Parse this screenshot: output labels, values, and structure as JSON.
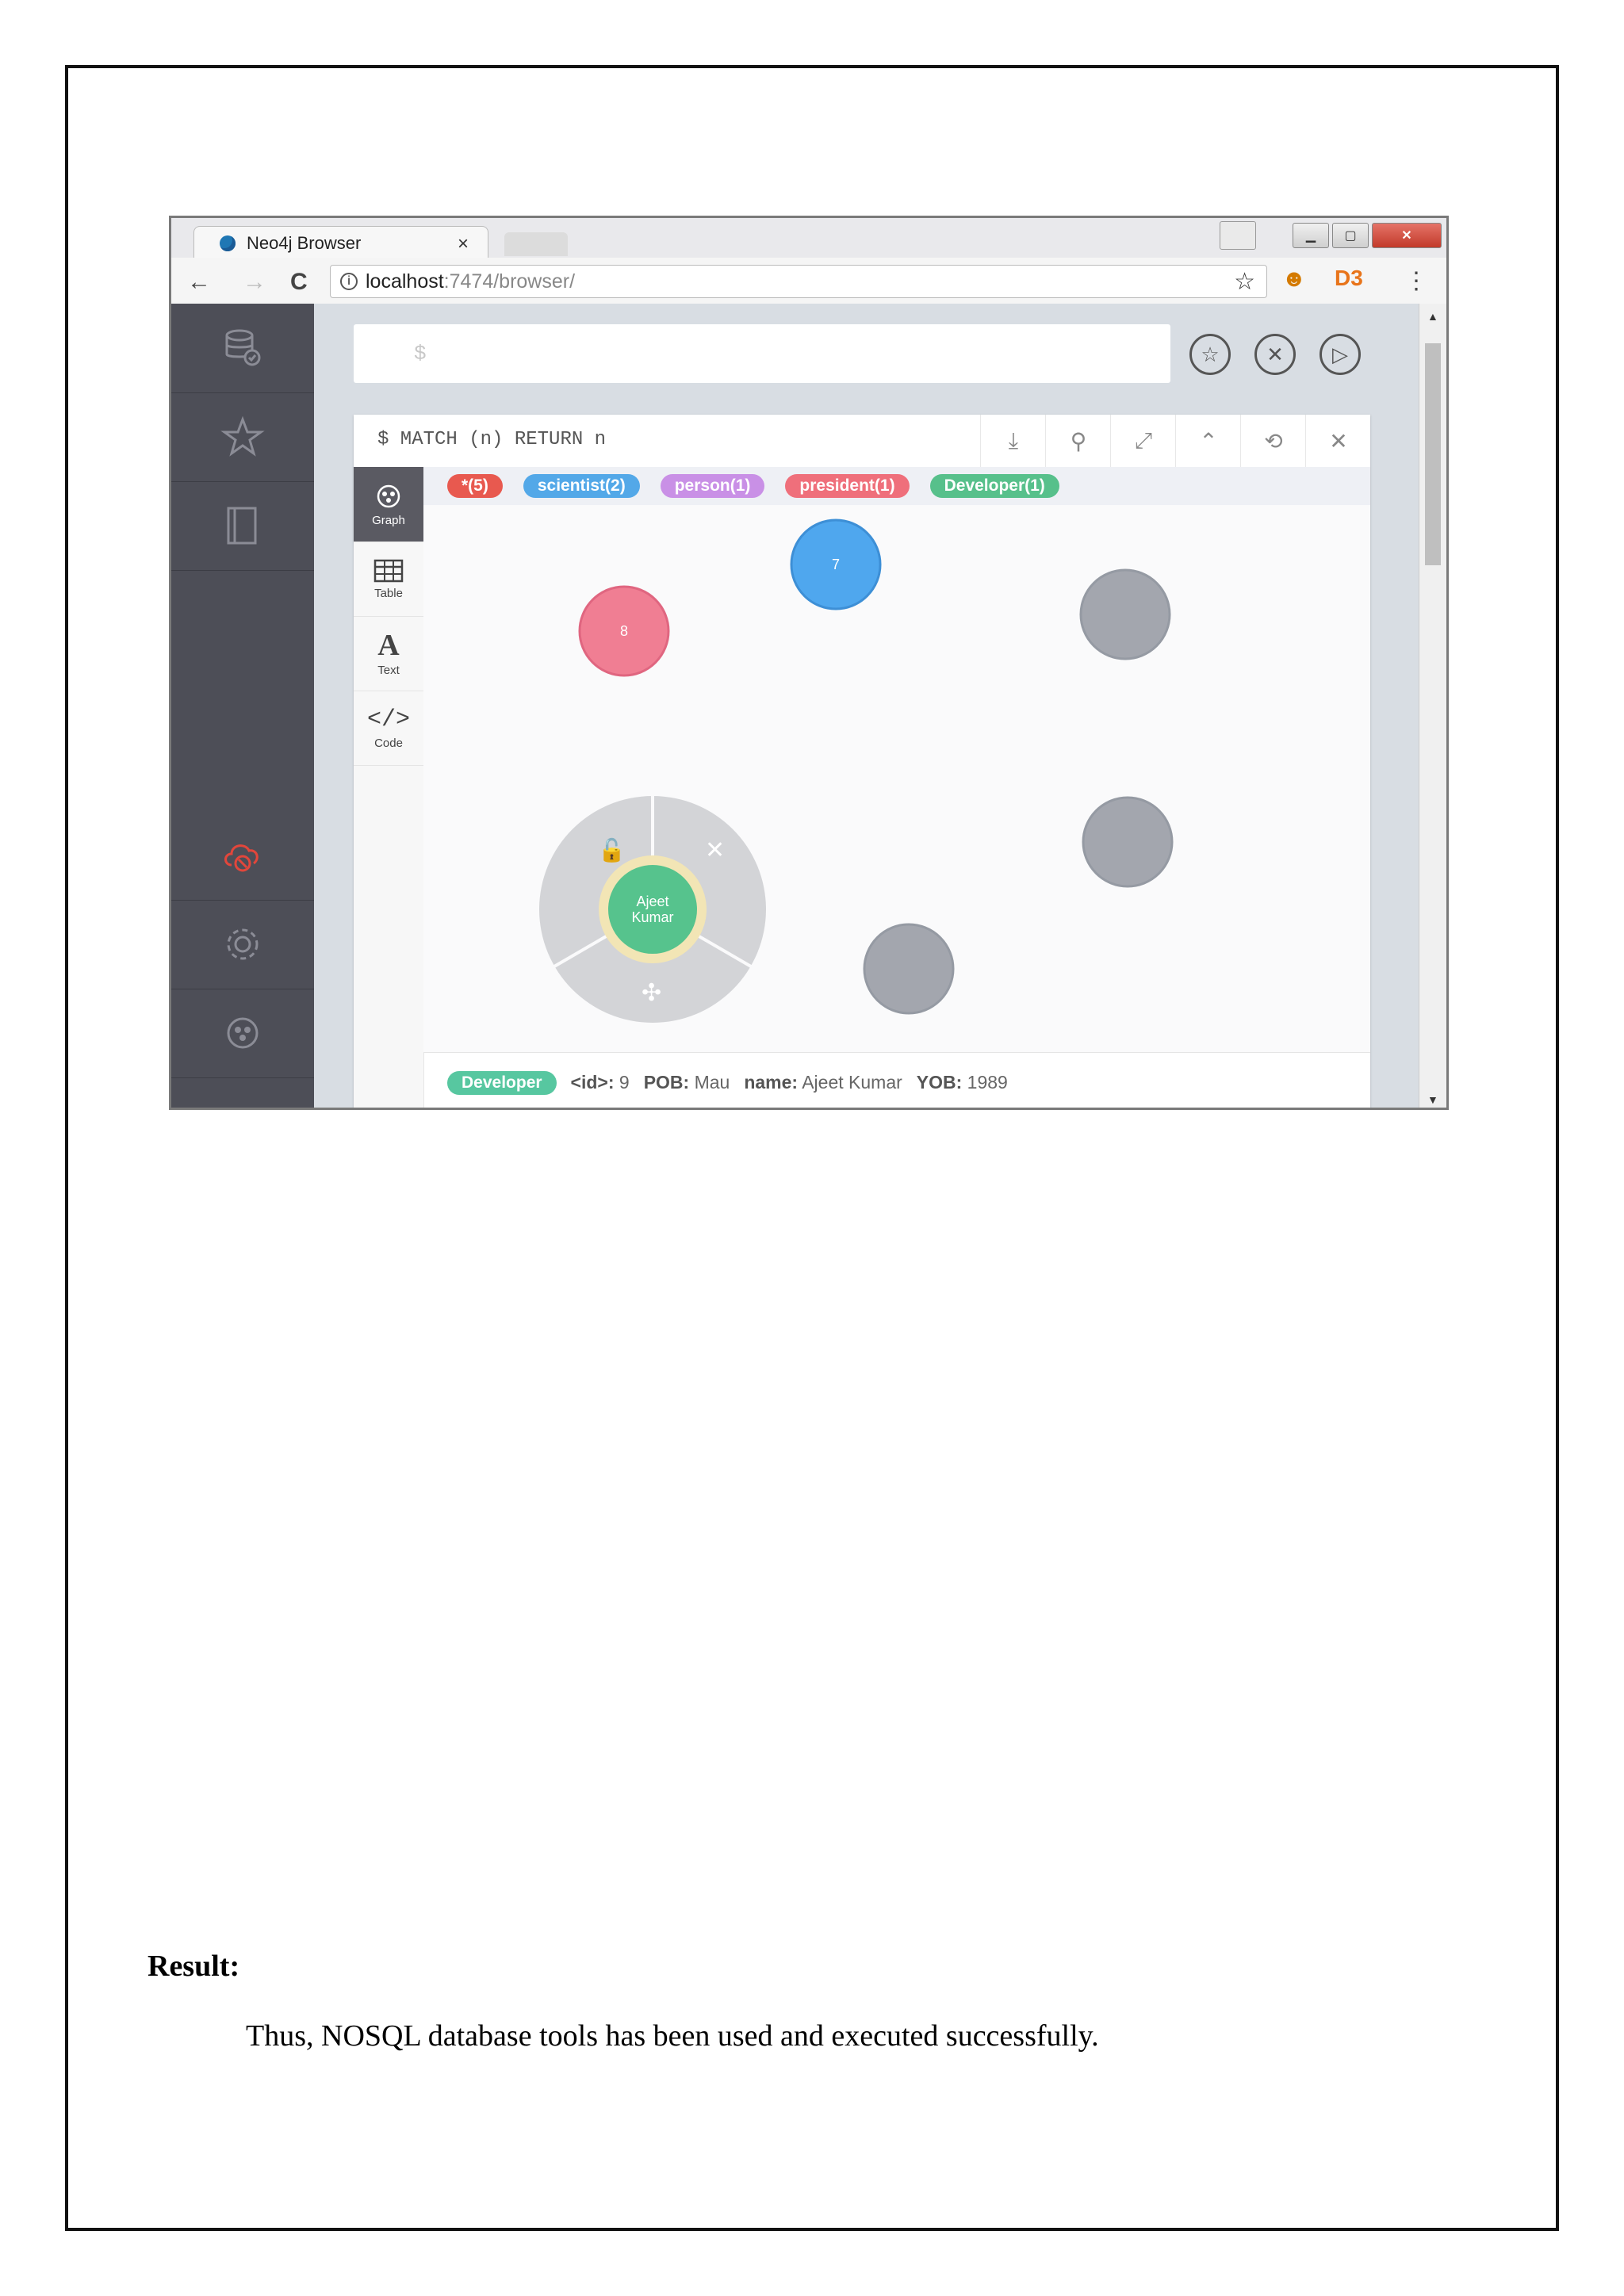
{
  "browser": {
    "tab_title": "Neo4j Browser",
    "tab_close": "×",
    "url_host": "localhost",
    "url_path": ":7474/browser/",
    "back": "←",
    "forward": "→",
    "reload": "C",
    "bookmark_star": "☆",
    "menu": "⋮"
  },
  "editor": {
    "prompt": "$"
  },
  "frame": {
    "query": "$ MATCH (n) RETURN n",
    "tabs": [
      "Graph",
      "Table",
      "Text",
      "Code"
    ],
    "active_tab": "Graph"
  },
  "legend": [
    {
      "label": "*(5)",
      "color": "#e8594f"
    },
    {
      "label": "scientist(2)",
      "color": "#53a8e8"
    },
    {
      "label": "person(1)",
      "color": "#c990e6"
    },
    {
      "label": "president(1)",
      "color": "#ef6f7b"
    },
    {
      "label": "Developer(1)",
      "color": "#57c08b"
    }
  ],
  "nodes": [
    {
      "label": "7",
      "color": "#4fa7ee",
      "ring": "#3d8fd6"
    },
    {
      "label": "8",
      "color": "#f07e93",
      "ring": "#e06680"
    },
    {
      "label": "",
      "color": "#a3a6ae",
      "ring": "#959aa3"
    },
    {
      "label": "",
      "color": "#a3a6ae",
      "ring": "#959aa3"
    },
    {
      "label": "",
      "color": "#a3a6ae",
      "ring": "#959aa3"
    },
    {
      "label": "Ajeet Kumar",
      "color": "#56c38d",
      "ring": "#f2e5b5"
    }
  ],
  "selected_node": {
    "label_line1": "Ajeet",
    "label_line2": "Kumar"
  },
  "status": {
    "label": "Developer",
    "id_key": "<id>:",
    "id_val": "9",
    "pob_key": "POB:",
    "pob_val": "Mau",
    "name_key": "name:",
    "name_val": "Ajeet Kumar",
    "yob_key": "YOB:",
    "yob_val": "1989"
  },
  "document": {
    "result_heading": "Result:",
    "result_text": "Thus, NOSQL database tools has been used and executed successfully."
  }
}
